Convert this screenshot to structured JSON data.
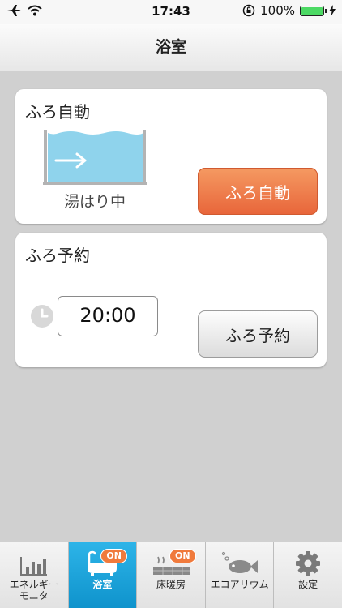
{
  "status_bar": {
    "time": "17:43",
    "battery": "100%",
    "icons": [
      "airplane-icon",
      "wifi-icon",
      "rotation-lock-icon",
      "battery-icon",
      "charging-icon"
    ]
  },
  "header": {
    "title": "浴室"
  },
  "auto_card": {
    "title": "ふろ自動",
    "status": "湯はり中",
    "button_label": "ふろ自動",
    "colors": {
      "button": "#e8653a",
      "water": "#8fd3ec"
    }
  },
  "reserve_card": {
    "title": "ふろ予約",
    "time_value": "20:00",
    "button_label": "ふろ予約"
  },
  "tabs": [
    {
      "label": "エネルギー\nモニタ",
      "icon": "bar-chart-icon",
      "active": false
    },
    {
      "label": "浴室",
      "icon": "bathtub-icon",
      "badge": "ON",
      "active": true
    },
    {
      "label": "床暖房",
      "icon": "floor-heating-icon",
      "badge": "ON",
      "active": false
    },
    {
      "label": "エコアリウム",
      "icon": "fish-icon",
      "active": false
    },
    {
      "label": "設定",
      "icon": "gear-icon",
      "active": false
    }
  ],
  "colors": {
    "accent": "#1aa3dc",
    "badge": "#f07a3c"
  }
}
